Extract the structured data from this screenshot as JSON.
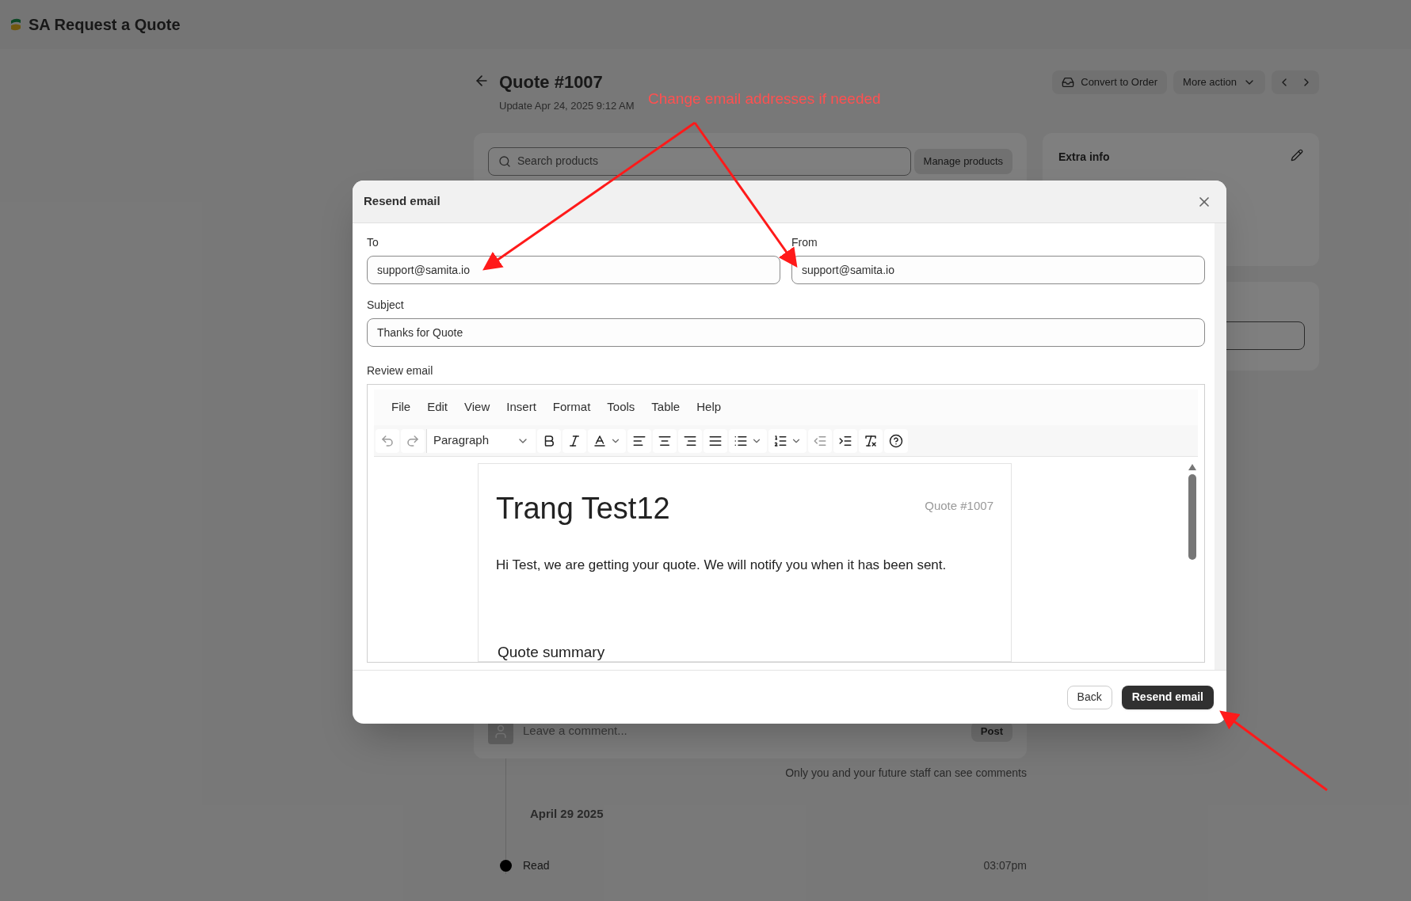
{
  "app": {
    "title": "SA Request a Quote"
  },
  "page": {
    "title": "Quote #1007",
    "subtitle": "Update Apr 24, 2025 9:12 AM",
    "actions": [
      {
        "label": "Convert to Order",
        "kind": "convert"
      },
      {
        "label": "More action",
        "kind": "menu"
      }
    ],
    "search": {
      "placeholder": "Search products"
    },
    "manage_button": "Manage products",
    "extra_info": {
      "title": "Extra info"
    },
    "comment": {
      "placeholder": "Leave a comment...",
      "button": "Post",
      "note": "Only you and your future staff can see comments"
    },
    "timeline": {
      "date": "April 29 2025",
      "events": [
        {
          "label": "Read",
          "time": "03:07pm"
        }
      ]
    }
  },
  "dialog": {
    "title": "Resend email",
    "fields": [
      {
        "label": "To",
        "value": "support@samita.io"
      },
      {
        "label": "From",
        "value": "support@samita.io"
      }
    ],
    "subject": {
      "label": "Subject",
      "value": "Thanks for Quote"
    },
    "review_label": "Review email",
    "editor": {
      "menu": [
        "File",
        "Edit",
        "View",
        "Insert",
        "Format",
        "Tools",
        "Table",
        "Help"
      ],
      "block_format": "Paragraph",
      "email": {
        "heading": "Trang Test12",
        "quote_number": "Quote #1007",
        "message": "Hi Test, we are getting your quote. We will notify you when it has been sent.",
        "section": "Quote summary"
      }
    },
    "buttons": [
      {
        "label": "Back",
        "kind": "secondary"
      },
      {
        "label": "Resend email",
        "kind": "primary"
      }
    ]
  },
  "annotation": {
    "text": "Change email addresses if needed"
  }
}
